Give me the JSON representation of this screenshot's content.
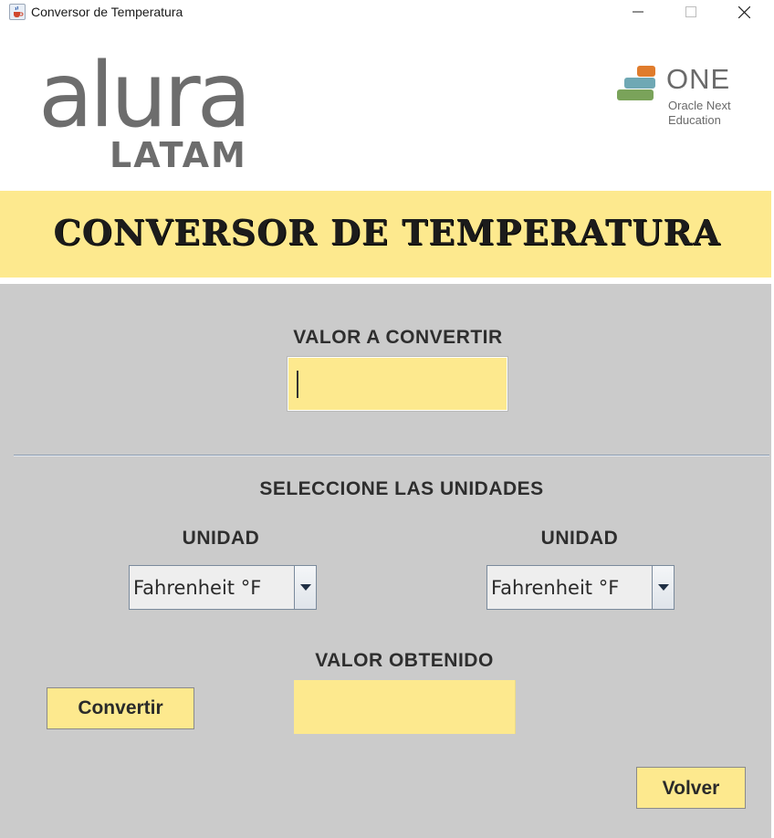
{
  "window": {
    "title": "Conversor de Temperatura",
    "app_icon": "java-cup-icon",
    "controls": [
      "minimize-icon",
      "maximize-icon",
      "close-icon"
    ]
  },
  "header": {
    "alura_logo": {
      "word": "alura",
      "sub": "LATAM"
    },
    "one_logo": {
      "title": "ONE",
      "line1": "Oracle Next",
      "line2": "Education"
    }
  },
  "banner": {
    "title": "CONVERSOR DE TEMPERATURA"
  },
  "form": {
    "valor_label": "VALOR A CONVERTIR",
    "valor_input": "",
    "select_label": "SELECCIONE LAS UNIDADES",
    "unidad_from_label": "UNIDAD",
    "unidad_to_label": "UNIDAD",
    "unidad_from_value": "Fahrenheit °F",
    "unidad_to_value": "Fahrenheit °F",
    "obtenido_label": "VALOR OBTENIDO",
    "obtenido_value": "",
    "convertir_label": "Convertir",
    "volver_label": "Volver"
  },
  "colors": {
    "accent_yellow": "#fde98e",
    "panel_gray": "#cbcbcb",
    "logo_gray": "#6d6d6d",
    "one_orange": "#e07c2c",
    "one_teal": "#6fa8b4",
    "one_green": "#7aa35a"
  }
}
